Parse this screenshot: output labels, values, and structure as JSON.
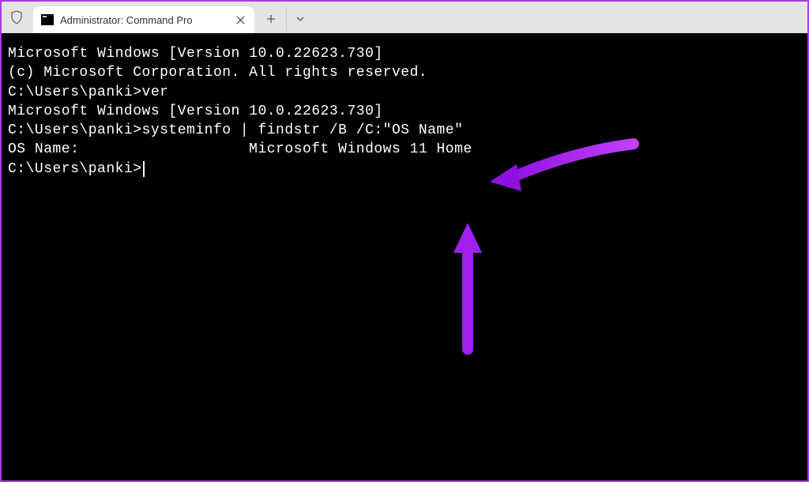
{
  "tab": {
    "title": "Administrator: Command Pro"
  },
  "terminal": {
    "lines": [
      "Microsoft Windows [Version 10.0.22623.730]",
      "(c) Microsoft Corporation. All rights reserved.",
      "",
      "C:\\Users\\panki>ver",
      "",
      "Microsoft Windows [Version 10.0.22623.730]",
      "",
      "C:\\Users\\panki>systeminfo | findstr /B /C:\"OS Name\"",
      "OS Name:                   Microsoft Windows 11 Home",
      "",
      "C:\\Users\\panki>"
    ]
  },
  "annotation": {
    "arrow_color": "#a020f0"
  }
}
